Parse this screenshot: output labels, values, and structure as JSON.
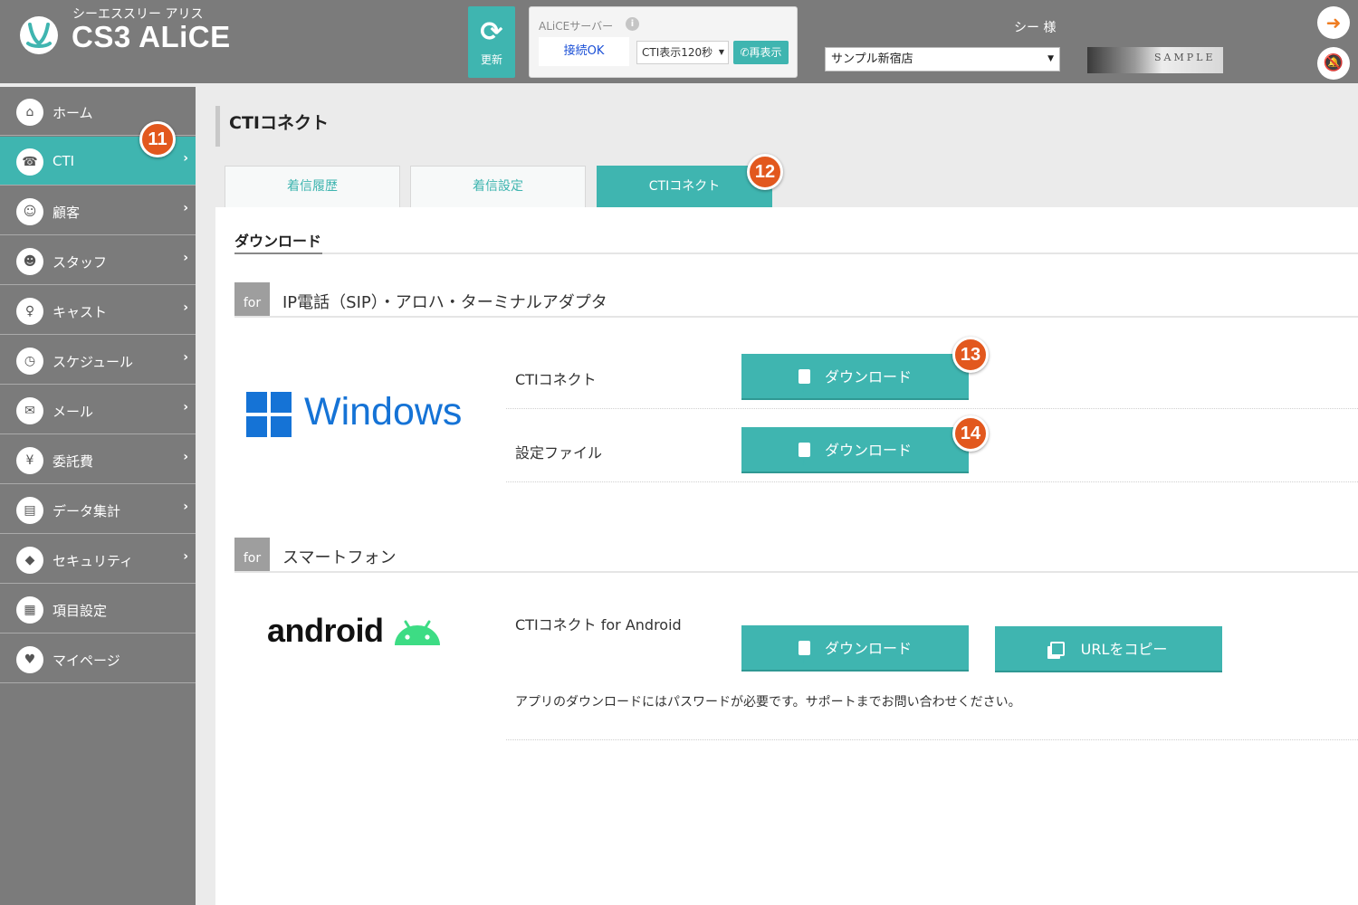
{
  "header": {
    "logo_sub": "シーエススリー アリス",
    "logo_title": "CS3 ALiCE",
    "refresh_label": "更新",
    "server_title": "ALiCEサーバー",
    "info_icon": "i",
    "connection_status": "接続OK",
    "cti_display_select": "CTI表示120秒",
    "redisplay_label": "再表示",
    "user_name": "シー 様",
    "store_select": "サンプル新宿店",
    "sample_text": "SAMPLE"
  },
  "sidebar": {
    "items": [
      {
        "label": "ホーム",
        "icon": "home-icon",
        "chevron": false
      },
      {
        "label": "CTI",
        "icon": "phone-icon",
        "chevron": true,
        "active": true
      },
      {
        "label": "顧客",
        "icon": "customer-icon",
        "chevron": true
      },
      {
        "label": "スタッフ",
        "icon": "staff-icon",
        "chevron": true
      },
      {
        "label": "キャスト",
        "icon": "cast-icon",
        "chevron": true
      },
      {
        "label": "スケジュール",
        "icon": "clock-icon",
        "chevron": true
      },
      {
        "label": "メール",
        "icon": "mail-icon",
        "chevron": true
      },
      {
        "label": "委託費",
        "icon": "wallet-icon",
        "chevron": true
      },
      {
        "label": "データ集計",
        "icon": "data-icon",
        "chevron": true
      },
      {
        "label": "セキュリティ",
        "icon": "shield-icon",
        "chevron": true
      },
      {
        "label": "項目設定",
        "icon": "clipboard-icon",
        "chevron": false
      },
      {
        "label": "マイページ",
        "icon": "mypage-icon",
        "chevron": false
      }
    ]
  },
  "badges": {
    "b11": "11",
    "b12": "12",
    "b13": "13",
    "b14": "14"
  },
  "main": {
    "page_title": "CTIコネクト",
    "tabs": [
      {
        "label": "着信履歴"
      },
      {
        "label": "着信設定"
      },
      {
        "label": "CTIコネクト",
        "active": true
      }
    ],
    "section_title": "ダウンロード",
    "for_tag": "for",
    "windows_group": {
      "title": "IP電話（SIP）・アロハ・ターミナルアダプタ",
      "logo_text": "Windows",
      "rows": [
        {
          "label": "CTIコネクト",
          "button": "ダウンロード"
        },
        {
          "label": "設定ファイル",
          "button": "ダウンロード"
        }
      ]
    },
    "smartphone_group": {
      "title": "スマートフォン",
      "logo_text": "android",
      "row_label": "CTIコネクト for Android",
      "download_button": "ダウンロード",
      "copy_button": "URLをコピー",
      "note": "アプリのダウンロードにはパスワードが必要です。サポートまでお問い合わせください。"
    }
  },
  "colors": {
    "accent": "#3fb5b0",
    "header_bg": "#7b7b7b",
    "badge": "#e2581e",
    "windows_blue": "#1573d6",
    "android_green": "#3ddc84"
  }
}
